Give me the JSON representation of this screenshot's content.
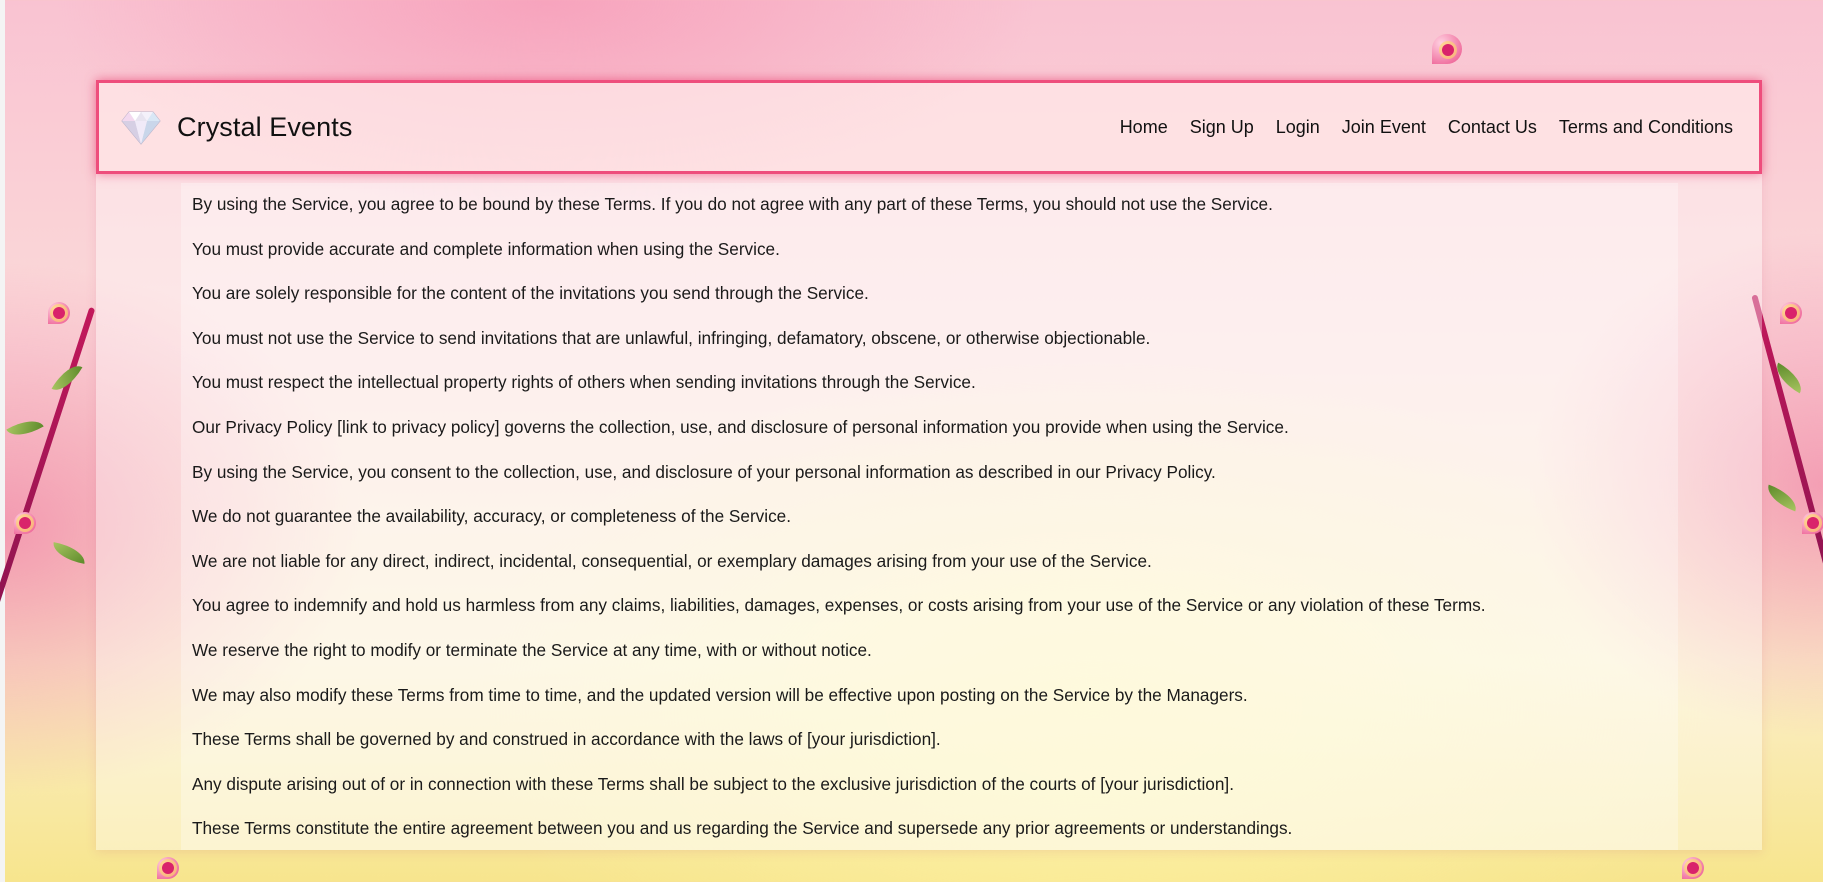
{
  "header": {
    "brand": "Crystal Events",
    "logo_icon": "diamond-icon",
    "nav": [
      {
        "label": "Home"
      },
      {
        "label": "Sign Up"
      },
      {
        "label": "Login"
      },
      {
        "label": "Join Event"
      },
      {
        "label": "Contact Us"
      },
      {
        "label": "Terms and Conditions"
      }
    ]
  },
  "colors": {
    "header_border": "#ee4d7c",
    "text": "#1a1a1a"
  },
  "terms": [
    "By using the Service, you agree to be bound by these Terms. If you do not agree with any part of these Terms, you should not use the Service.",
    "You must provide accurate and complete information when using the Service.",
    "You are solely responsible for the content of the invitations you send through the Service.",
    "You must not use the Service to send invitations that are unlawful, infringing, defamatory, obscene, or otherwise objectionable.",
    "You must respect the intellectual property rights of others when sending invitations through the Service.",
    "Our Privacy Policy [link to privacy policy] governs the collection, use, and disclosure of personal information you provide when using the Service.",
    "By using the Service, you consent to the collection, use, and disclosure of your personal information as described in our Privacy Policy.",
    "We do not guarantee the availability, accuracy, or completeness of the Service.",
    "We are not liable for any direct, indirect, incidental, consequential, or exemplary damages arising from your use of the Service.",
    "You agree to indemnify and hold us harmless from any claims, liabilities, damages, expenses, or costs arising from your use of the Service or any violation of these Terms.",
    "We reserve the right to modify or terminate the Service at any time, with or without notice.",
    "We may also modify these Terms from time to time, and the updated version will be effective upon posting on the Service by the Managers.",
    "These Terms shall be governed by and construed in accordance with the laws of [your jurisdiction].",
    "Any dispute arising out of or in connection with these Terms shall be subject to the exclusive jurisdiction of the courts of [your jurisdiction].",
    "These Terms constitute the entire agreement between you and us regarding the Service and supersede any prior agreements or understandings."
  ]
}
